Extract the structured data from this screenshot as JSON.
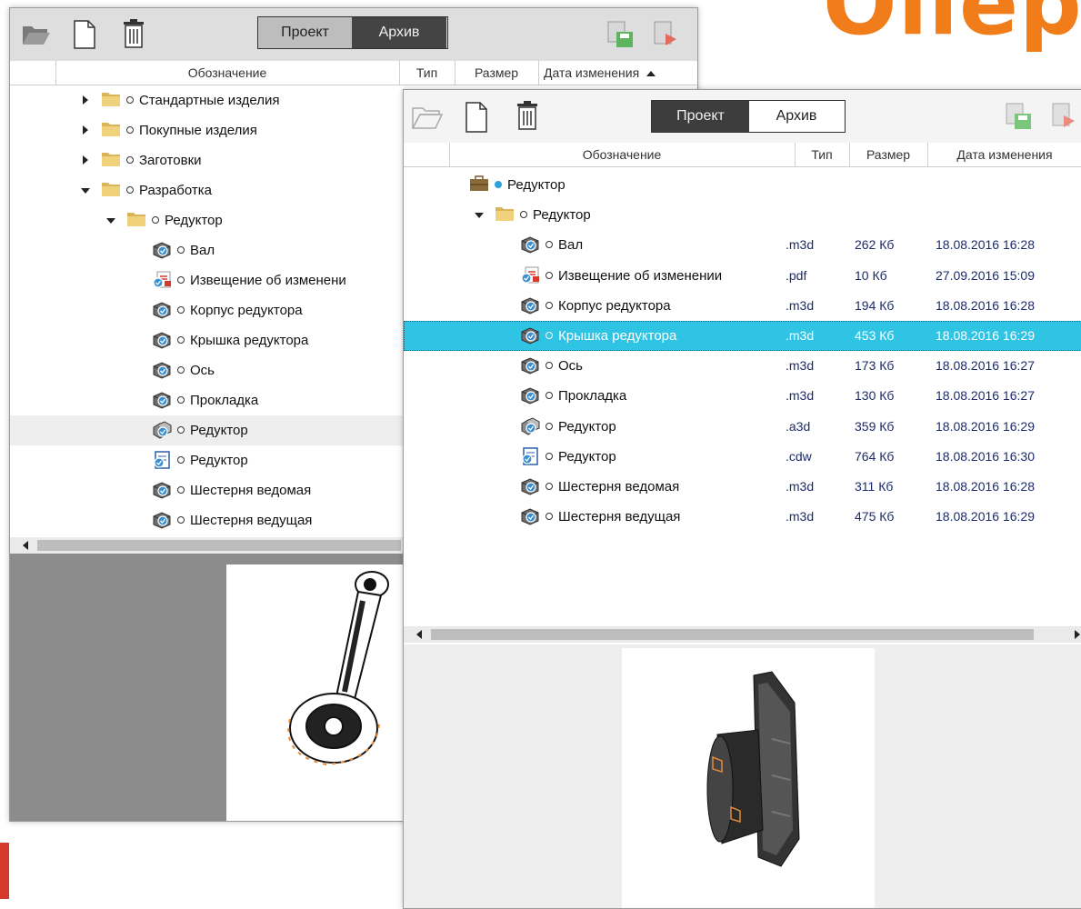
{
  "background": {
    "title_fragment": "Опер",
    "accent_color": "#f07d1a"
  },
  "window_back": {
    "toolbar": {
      "open_icon": "folder-open-icon",
      "new_icon": "new-file-icon",
      "delete_icon": "trash-icon",
      "tab_project": "Проект",
      "tab_archive": "Архив",
      "save_icon": "save-icon",
      "export_icon": "export-icon"
    },
    "columns": {
      "name": "Обозначение",
      "type": "Тип",
      "size": "Размер",
      "date": "Дата изменения"
    },
    "tree": [
      {
        "label": "Стандартные изделия",
        "level": 0,
        "expander": "right",
        "icon": "folder-icon"
      },
      {
        "label": "Покупные изделия",
        "level": 0,
        "expander": "right",
        "icon": "folder-icon"
      },
      {
        "label": "Заготовки",
        "level": 0,
        "expander": "right",
        "icon": "folder-icon"
      },
      {
        "label": "Разработка",
        "level": 0,
        "expander": "down",
        "icon": "folder-icon"
      },
      {
        "label": "Редуктор",
        "level": 1,
        "expander": "down",
        "icon": "folder-icon"
      },
      {
        "label": "Вал",
        "level": 2,
        "expander": "",
        "icon": "part-icon"
      },
      {
        "label": "Извещение об изменени",
        "level": 2,
        "expander": "",
        "icon": "pdf-icon"
      },
      {
        "label": "Корпус редуктора",
        "level": 2,
        "expander": "",
        "icon": "part-icon"
      },
      {
        "label": "Крышка редуктора",
        "level": 2,
        "expander": "",
        "icon": "part-icon"
      },
      {
        "label": "Ось",
        "level": 2,
        "expander": "",
        "icon": "part-icon"
      },
      {
        "label": "Прокладка",
        "level": 2,
        "expander": "",
        "icon": "part-icon"
      },
      {
        "label": "Редуктор",
        "level": 2,
        "expander": "",
        "icon": "assembly-icon",
        "hover": true
      },
      {
        "label": "Редуктор",
        "level": 2,
        "expander": "",
        "icon": "drawing-icon"
      },
      {
        "label": "Шестерня ведомая",
        "level": 2,
        "expander": "",
        "icon": "part-icon"
      },
      {
        "label": "Шестерня ведущая",
        "level": 2,
        "expander": "",
        "icon": "part-icon"
      }
    ]
  },
  "window_front": {
    "toolbar": {
      "open_icon": "folder-open-icon",
      "new_icon": "new-file-icon",
      "delete_icon": "trash-icon",
      "tab_project": "Проект",
      "tab_archive": "Архив",
      "save_icon": "save-icon",
      "export_icon": "export-icon"
    },
    "columns": {
      "name": "Обозначение",
      "type": "Тип",
      "size": "Размер",
      "date": "Дата изменения"
    },
    "tree": [
      {
        "label": "Редуктор",
        "level": 0,
        "expander": "",
        "icon": "briefcase-icon",
        "dot": "blue"
      },
      {
        "label": "Редуктор",
        "level": 1,
        "expander": "down",
        "icon": "folder-icon"
      },
      {
        "label": "Вал",
        "level": 2,
        "icon": "part-icon",
        "type": ".m3d",
        "size": "262 Кб",
        "date": "18.08.2016 16:28"
      },
      {
        "label": "Извещение об изменении",
        "level": 2,
        "icon": "pdf-icon",
        "type": ".pdf",
        "size": "10 Кб",
        "date": "27.09.2016 15:09"
      },
      {
        "label": "Корпус редуктора",
        "level": 2,
        "icon": "part-icon",
        "type": ".m3d",
        "size": "194 Кб",
        "date": "18.08.2016 16:28"
      },
      {
        "label": "Крышка редуктора",
        "level": 2,
        "icon": "part-icon",
        "type": ".m3d",
        "size": "453 Кб",
        "date": "18.08.2016 16:29",
        "selected": true
      },
      {
        "label": "Ось",
        "level": 2,
        "icon": "part-icon",
        "type": ".m3d",
        "size": "173 Кб",
        "date": "18.08.2016 16:27"
      },
      {
        "label": "Прокладка",
        "level": 2,
        "icon": "part-icon",
        "type": ".m3d",
        "size": "130 Кб",
        "date": "18.08.2016 16:27"
      },
      {
        "label": "Редуктор",
        "level": 2,
        "icon": "assembly-icon",
        "type": ".a3d",
        "size": "359 Кб",
        "date": "18.08.2016 16:29"
      },
      {
        "label": "Редуктор",
        "level": 2,
        "icon": "drawing-icon",
        "type": ".cdw",
        "size": "764 Кб",
        "date": "18.08.2016 16:30"
      },
      {
        "label": "Шестерня ведомая",
        "level": 2,
        "icon": "part-icon",
        "type": ".m3d",
        "size": "311 Кб",
        "date": "18.08.2016 16:28"
      },
      {
        "label": "Шестерня ведущая",
        "level": 2,
        "icon": "part-icon",
        "type": ".m3d",
        "size": "475 Кб",
        "date": "18.08.2016 16:29"
      }
    ]
  },
  "colors": {
    "selection": "#2fc3e4",
    "date_text": "#1c2b6b",
    "folder": "#e8c46a"
  }
}
